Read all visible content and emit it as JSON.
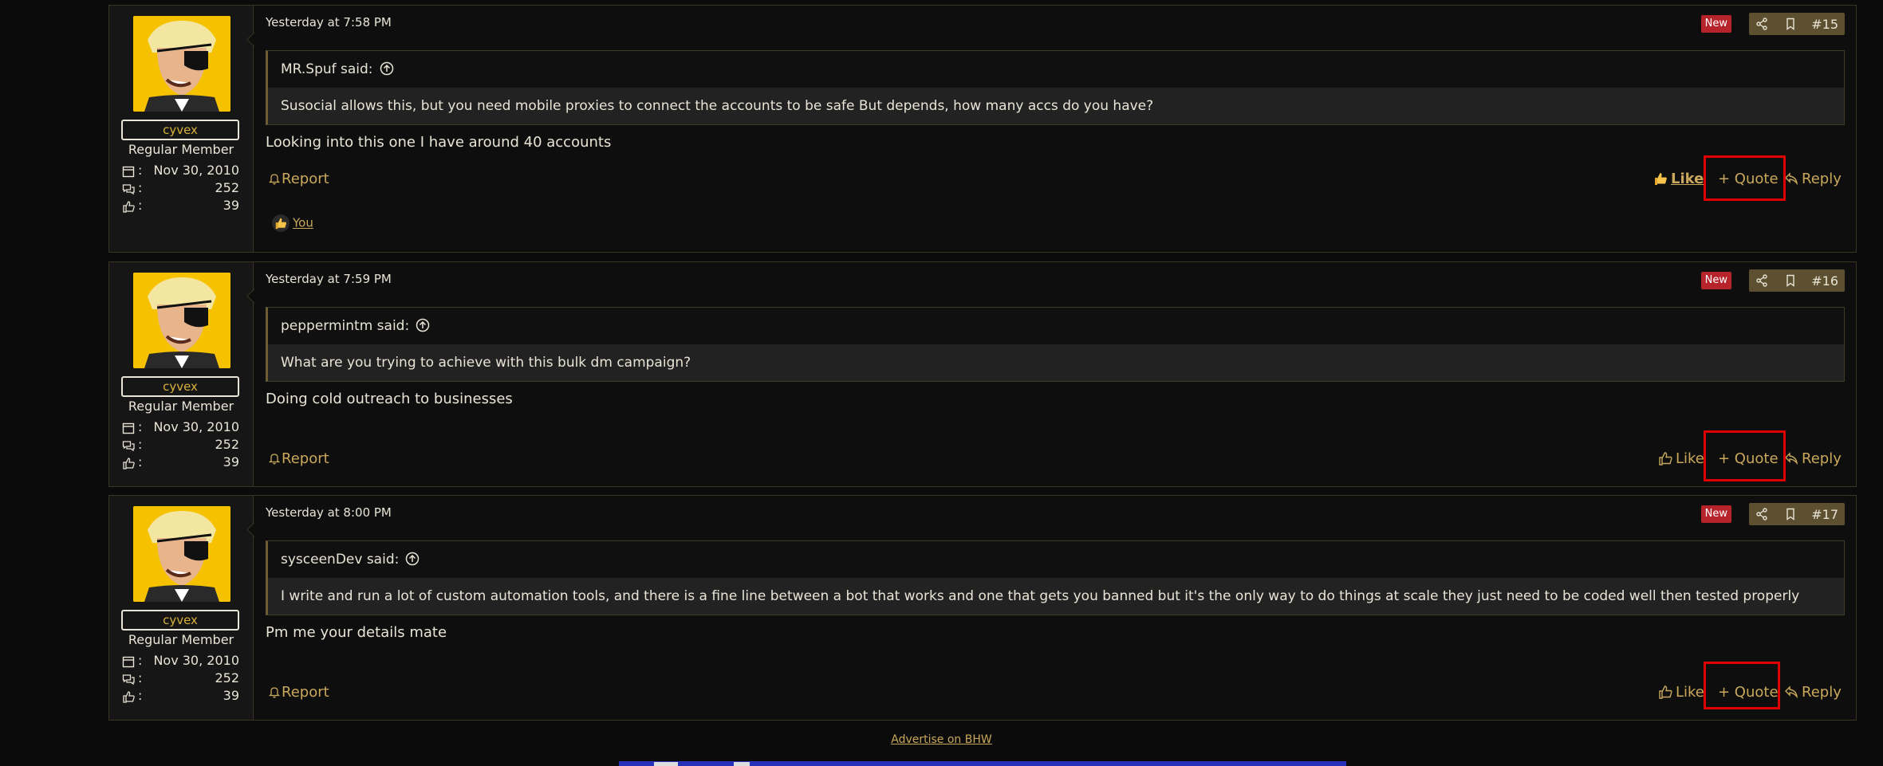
{
  "posts": [
    {
      "username": "cyvex",
      "user_title": "Regular Member",
      "joined": "Nov 30, 2010",
      "messages": "252",
      "reactions": "39",
      "date": "Yesterday at 7:58 PM",
      "new_badge": "New",
      "post_number": "#15",
      "quote_author": "MR.Spuf said:",
      "quote_text": "Susocial allows this, but you need mobile proxies to connect the accounts to be safe But depends, how many accs do you have?",
      "message": "Looking into this one I have around 40 accounts",
      "report_label": "Report",
      "like_label": "Like",
      "quote_label": "+ Quote",
      "reply_label": "Reply",
      "reaction_user": "You"
    },
    {
      "username": "cyvex",
      "user_title": "Regular Member",
      "joined": "Nov 30, 2010",
      "messages": "252",
      "reactions": "39",
      "date": "Yesterday at 7:59 PM",
      "new_badge": "New",
      "post_number": "#16",
      "quote_author": "peppermintm said:",
      "quote_text": "What are you trying to achieve with this bulk dm campaign?",
      "message": "Doing cold outreach to businesses",
      "report_label": "Report",
      "like_label": "Like",
      "quote_label": "+ Quote",
      "reply_label": "Reply"
    },
    {
      "username": "cyvex",
      "user_title": "Regular Member",
      "joined": "Nov 30, 2010",
      "messages": "252",
      "reactions": "39",
      "date": "Yesterday at 8:00 PM",
      "new_badge": "New",
      "post_number": "#17",
      "quote_author": "sysceenDev said:",
      "quote_text": "I write and run a lot of custom automation tools, and there is a fine line between a bot that works and one that gets you banned but it's the only way to do things at scale they just need to be coded well then tested properly",
      "message": "Pm me your details mate",
      "report_label": "Report",
      "like_label": "Like",
      "quote_label": "+ Quote",
      "reply_label": "Reply"
    }
  ],
  "footer": {
    "advertise_link": "Advertise on BHW"
  },
  "colors": {
    "accent": "#c9a85b",
    "new_badge": "#b7232b",
    "highlight_box": "#e00000"
  },
  "icons": [
    "calendar-icon",
    "messages-icon",
    "thumbs-up-icon",
    "share-icon",
    "bookmark-icon",
    "bell-icon",
    "reply-icon",
    "arrow-up-circle-icon"
  ]
}
